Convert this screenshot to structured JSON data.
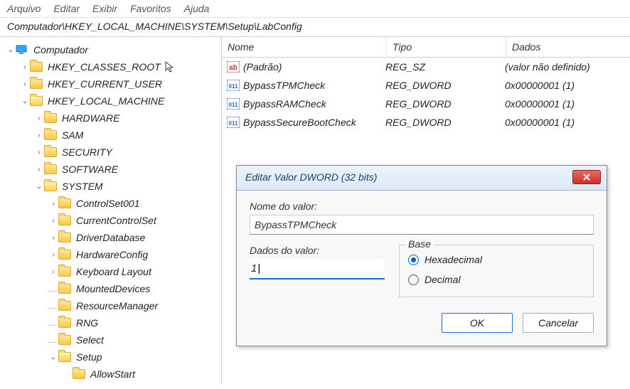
{
  "menu": {
    "file": "Arquivo",
    "edit": "Editar",
    "view": "Exibir",
    "favorites": "Favoritos",
    "help": "Ajuda"
  },
  "address": "Computador\\HKEY_LOCAL_MACHINE\\SYSTEM\\Setup\\LabConfig",
  "tree": {
    "root": "Computador",
    "hkcr": "HKEY_CLASSES_ROOT",
    "hkcu": "HKEY_CURRENT_USER",
    "hklm": "HKEY_LOCAL_MACHINE",
    "hardware": "HARDWARE",
    "sam": "SAM",
    "security": "SECURITY",
    "software": "SOFTWARE",
    "system": "SYSTEM",
    "controlset001": "ControlSet001",
    "currentcontrolset": "CurrentControlSet",
    "driverdatabase": "DriverDatabase",
    "hardwareconfig": "HardwareConfig",
    "keyboardlayout": "Keyboard Layout",
    "mounteddevices": "MountedDevices",
    "resourcemanager": "ResourceManager",
    "rng": "RNG",
    "select": "Select",
    "setup": "Setup",
    "allowstart": "AllowStart"
  },
  "columns": {
    "name": "Nome",
    "type": "Tipo",
    "data": "Dados"
  },
  "values": [
    {
      "name": "(Padrão)",
      "type": "REG_SZ",
      "data": "(valor não definido)",
      "kind": "sz"
    },
    {
      "name": "BypassTPMCheck",
      "type": "REG_DWORD",
      "data": "0x00000001 (1)",
      "kind": "dw"
    },
    {
      "name": "BypassRAMCheck",
      "type": "REG_DWORD",
      "data": "0x00000001 (1)",
      "kind": "dw"
    },
    {
      "name": "BypassSecureBootCheck",
      "type": "REG_DWORD",
      "data": "0x00000001 (1)",
      "kind": "dw"
    }
  ],
  "dialog": {
    "title": "Editar Valor DWORD (32 bits)",
    "name_label": "Nome do valor:",
    "name_value": "BypassTPMCheck",
    "data_label": "Dados do valor:",
    "data_value": "1",
    "base_label": "Base",
    "hex": "Hexadecimal",
    "dec": "Decimal",
    "ok": "OK",
    "cancel": "Cancelar"
  }
}
